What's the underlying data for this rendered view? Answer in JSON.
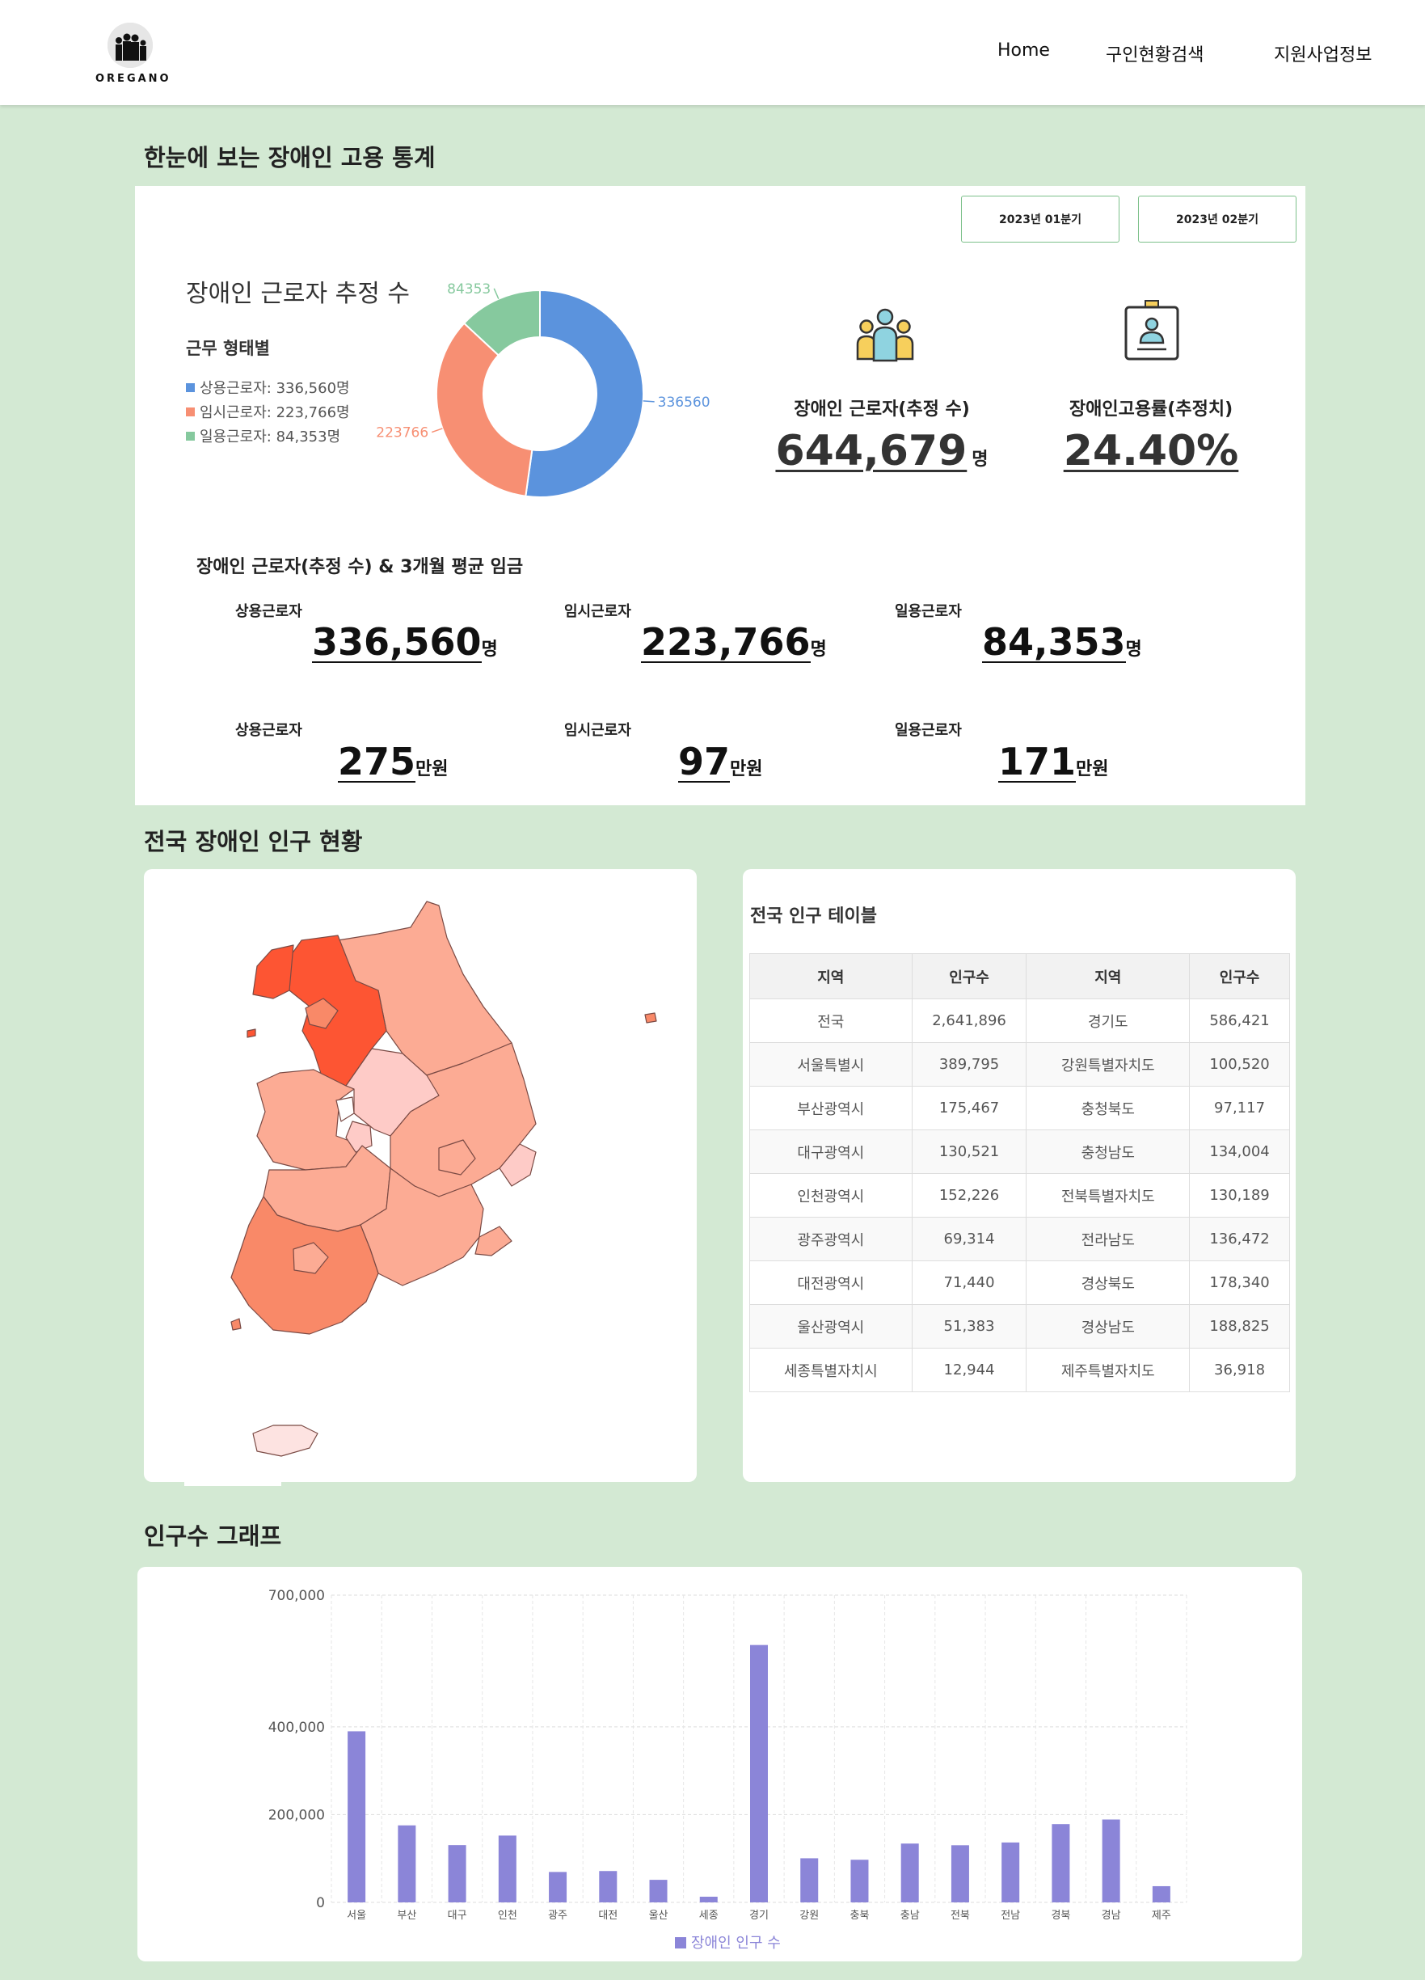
{
  "header": {
    "logo_text": "OREGANO",
    "nav": [
      {
        "label": "Home"
      },
      {
        "label": "구인현황검색"
      },
      {
        "label": "지원사업정보"
      }
    ]
  },
  "stats_section": {
    "title": "한눈에 보는 장애인 고용 통계",
    "quarter_buttons": [
      "2023년 01분기",
      "2023년 02분기"
    ],
    "donut_title": "장애인 근로자 추정 수",
    "donut_subtitle": "근무 형태별",
    "legend": [
      {
        "label": "상용근로자: 336,560명",
        "color": "#5b93dd"
      },
      {
        "label": "임시근로자: 223,766명",
        "color": "#f78f73"
      },
      {
        "label": "일용근로자: 84,353명",
        "color": "#86c99e"
      }
    ],
    "kpis": [
      {
        "label": "장애인 근로자(추정 수)",
        "value": "644,679",
        "unit": "명",
        "icon": "people-group-icon"
      },
      {
        "label": "장애인고용률(추정치)",
        "value": "24.40%",
        "unit": "",
        "icon": "id-badge-icon"
      }
    ],
    "wage_title": "장애인 근로자(추정 수) & 3개월 평균 임금",
    "workers": [
      {
        "label": "상용근로자",
        "value": "336,560",
        "unit": "명"
      },
      {
        "label": "임시근로자",
        "value": "223,766",
        "unit": "명"
      },
      {
        "label": "일용근로자",
        "value": "84,353",
        "unit": "명"
      }
    ],
    "wages": [
      {
        "label": "상용근로자",
        "value": "275",
        "unit": "만원"
      },
      {
        "label": "임시근로자",
        "value": "97",
        "unit": "만원"
      },
      {
        "label": "일용근로자",
        "value": "171",
        "unit": "만원"
      }
    ]
  },
  "population_section": {
    "title": "전국 장애인 인구 현황",
    "table_title": "전국 인구 테이블",
    "table_headers": [
      "지역",
      "인구수",
      "지역",
      "인구수"
    ],
    "table_rows": [
      [
        "전국",
        "2,641,896",
        "경기도",
        "586,421"
      ],
      [
        "서울특별시",
        "389,795",
        "강원특별자치도",
        "100,520"
      ],
      [
        "부산광역시",
        "175,467",
        "충청북도",
        "97,117"
      ],
      [
        "대구광역시",
        "130,521",
        "충청남도",
        "134,004"
      ],
      [
        "인천광역시",
        "152,226",
        "전북특별자치도",
        "130,189"
      ],
      [
        "광주광역시",
        "69,314",
        "전라남도",
        "136,472"
      ],
      [
        "대전광역시",
        "71,440",
        "경상북도",
        "178,340"
      ],
      [
        "울산광역시",
        "51,383",
        "경상남도",
        "188,825"
      ],
      [
        "세종특별자치시",
        "12,944",
        "제주특별자치도",
        "36,918"
      ]
    ],
    "map_colors": {
      "highest": "#fd5533",
      "high": "#f98968",
      "mid": "#fcab94",
      "low": "#fecbc7",
      "lowest": "#fde3e1"
    }
  },
  "graph_section": {
    "title": "인구수 그래프"
  },
  "chart_data": [
    {
      "type": "pie",
      "title": "장애인 근로자 추정 수",
      "subtitle": "근무 형태별",
      "labels": [
        "상용근로자",
        "임시근로자",
        "일용근로자"
      ],
      "values": [
        336560,
        223766,
        84353
      ],
      "data_labels": [
        "336560",
        "223766",
        "84353"
      ],
      "colors": [
        "#5b93dd",
        "#f78f73",
        "#86c99e"
      ],
      "donut": true,
      "legend_position": "left"
    },
    {
      "type": "bar",
      "categories": [
        "서울",
        "부산",
        "대구",
        "인천",
        "광주",
        "대전",
        "울산",
        "세종",
        "경기",
        "강원",
        "충북",
        "충남",
        "전북",
        "전남",
        "경북",
        "경남",
        "제주"
      ],
      "series": [
        {
          "name": "장애인 인구 수",
          "values": [
            389795,
            175467,
            130521,
            152226,
            69314,
            71440,
            51383,
            12944,
            586421,
            100520,
            97117,
            134004,
            130189,
            136472,
            178340,
            188825,
            36918
          ],
          "color": "#8b85d8"
        }
      ],
      "y_ticks": [
        0,
        200000,
        400000,
        700000
      ],
      "y_tick_labels": [
        "0",
        "200,000",
        "400,000",
        "700,000"
      ],
      "ylim": [
        0,
        700000
      ],
      "grid": true,
      "legend_position": "bottom"
    }
  ]
}
